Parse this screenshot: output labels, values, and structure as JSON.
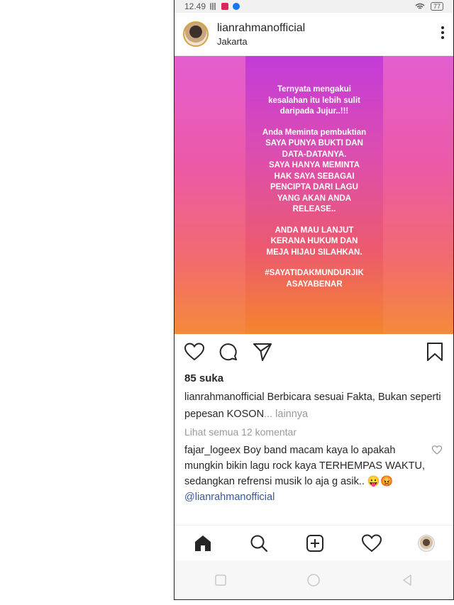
{
  "status_bar": {
    "time": "12.49",
    "battery": "77"
  },
  "post": {
    "username": "lianrahmanofficial",
    "location": "Jakarta",
    "image_text": [
      "Ternyata mengakui\nkesalahan itu lebih sulit\ndaripada Jujur..!!!",
      "Anda Meminta pembuktian\nSAYA PUNYA BUKTI DAN\nDATA-DATANYA.\nSAYA HANYA MEMINTA\nHAK SAYA SEBAGAI\nPENCIPTA DARI LAGU\nYANG AKAN ANDA\nRELEASE..",
      "ANDA MAU LANJUT\nKERANA HUKUM DAN\nMEJA HIJAU SILAHKAN.",
      "#SAYATIDAKMUNDURJIK\nASAYABENAR"
    ],
    "likes": "85 suka",
    "caption_user": "lianrahmanofficial",
    "caption_text": " Berbicara sesuai Fakta, Bukan seperti pepesan KOSON",
    "caption_more": "... lainnya",
    "view_all_comments": "Lihat semua 12 komentar",
    "comment": {
      "user": "fajar_logeex",
      "text": " Boy band macam kaya lo apakah mungkin bikin lagu rock kaya TERHEMPAS WAKTU, sedangkan refrensi musik lo aja g asik.. 😛😡",
      "mention": "@lianrahmanofficial"
    }
  },
  "colors": {
    "accent_gradient_top": "#c33bd9",
    "accent_gradient_bottom": "#f5852c",
    "mention": "#385898"
  },
  "icons": {
    "actions": [
      "heart-icon",
      "comment-icon",
      "share-icon",
      "bookmark-icon"
    ],
    "nav": [
      "home-icon",
      "search-icon",
      "add-post-icon",
      "activity-heart-icon",
      "profile-avatar"
    ],
    "system": [
      "recent-apps-icon",
      "home-circle-icon",
      "back-icon"
    ]
  }
}
